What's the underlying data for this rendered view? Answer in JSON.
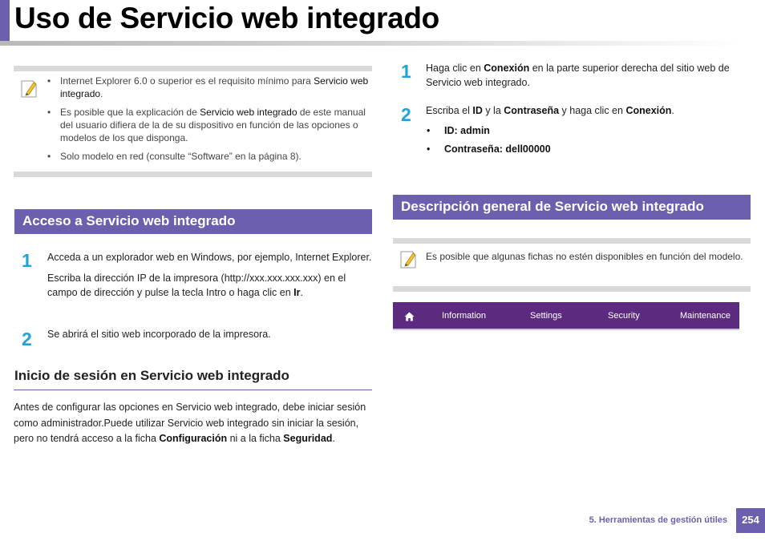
{
  "page": {
    "title": "Uso de Servicio web integrado",
    "footer_chapter": "5.  Herramientas de gestión útiles",
    "page_number": "254"
  },
  "note_left": {
    "icon": "note-pencil-icon",
    "items": [
      {
        "a": "Internet Explorer 6.0 o superior es el requisito mínimo para ",
        "b": "Servicio web integrado",
        "c": "."
      },
      {
        "a": "Es posible que la explicación de ",
        "b": "Servicio web integrado",
        "c": " de este manual del usuario difiera de la de su dispositivo en función de las opciones o modelos de los que disponga."
      },
      {
        "a": "Solo modelo en red (consulte “Software” en la página 8).",
        "b": "",
        "c": ""
      }
    ]
  },
  "access_section": {
    "heading": "Acceso a Servicio web integrado",
    "step1_num": "1",
    "step1_p1": "Acceda a un explorador web en Windows, por ejemplo, Internet Explorer.",
    "step1_p2_a": "Escriba la dirección IP de la impresora (http://xxx.xxx.xxx.xxx) en el campo de dirección y pulse la tecla Intro o haga clic en ",
    "step1_p2_b": "Ir",
    "step1_p2_c": ".",
    "step2_num": "2",
    "step2_text": "Se abrirá el sitio web incorporado de la impresora."
  },
  "login_section": {
    "heading": "Inicio de sesión en Servicio web integrado",
    "para_a": "Antes de configurar las opciones en Servicio web integrado, debe iniciar sesión como administrador.Puede utilizar Servicio web integrado sin iniciar la sesión, pero no tendrá acceso a la ficha ",
    "para_b": "Configuración",
    "para_c": " ni a la ficha ",
    "para_d": "Seguridad",
    "para_e": "."
  },
  "login_steps": {
    "step1_num": "1",
    "step1_a": "Haga clic en ",
    "step1_b": "Conexión",
    "step1_c": " en la parte superior derecha del sitio web de Servicio web integrado.",
    "step2_num": "2",
    "step2_a": "Escriba el ",
    "step2_b": "ID",
    "step2_c": " y la ",
    "step2_d": "Contraseña",
    "step2_e": " y haga clic en ",
    "step2_f": "Conexión",
    "step2_g": ".",
    "credentials": [
      "ID: admin",
      "Contraseña: dell00000"
    ]
  },
  "overview_section": {
    "heading": "Descripción general de Servicio web integrado",
    "note_icon": "note-pencil-icon",
    "note_text": "Es posible que algunas fichas no estén disponibles en función del modelo.",
    "nav": {
      "home_icon": "home-icon",
      "tabs": [
        "Information",
        "Settings",
        "Security",
        "Maintenance"
      ]
    }
  },
  "colors": {
    "accent": "#6b5fae",
    "step_number": "#1fa3d8",
    "nav_bar": "#5c2a7f"
  }
}
